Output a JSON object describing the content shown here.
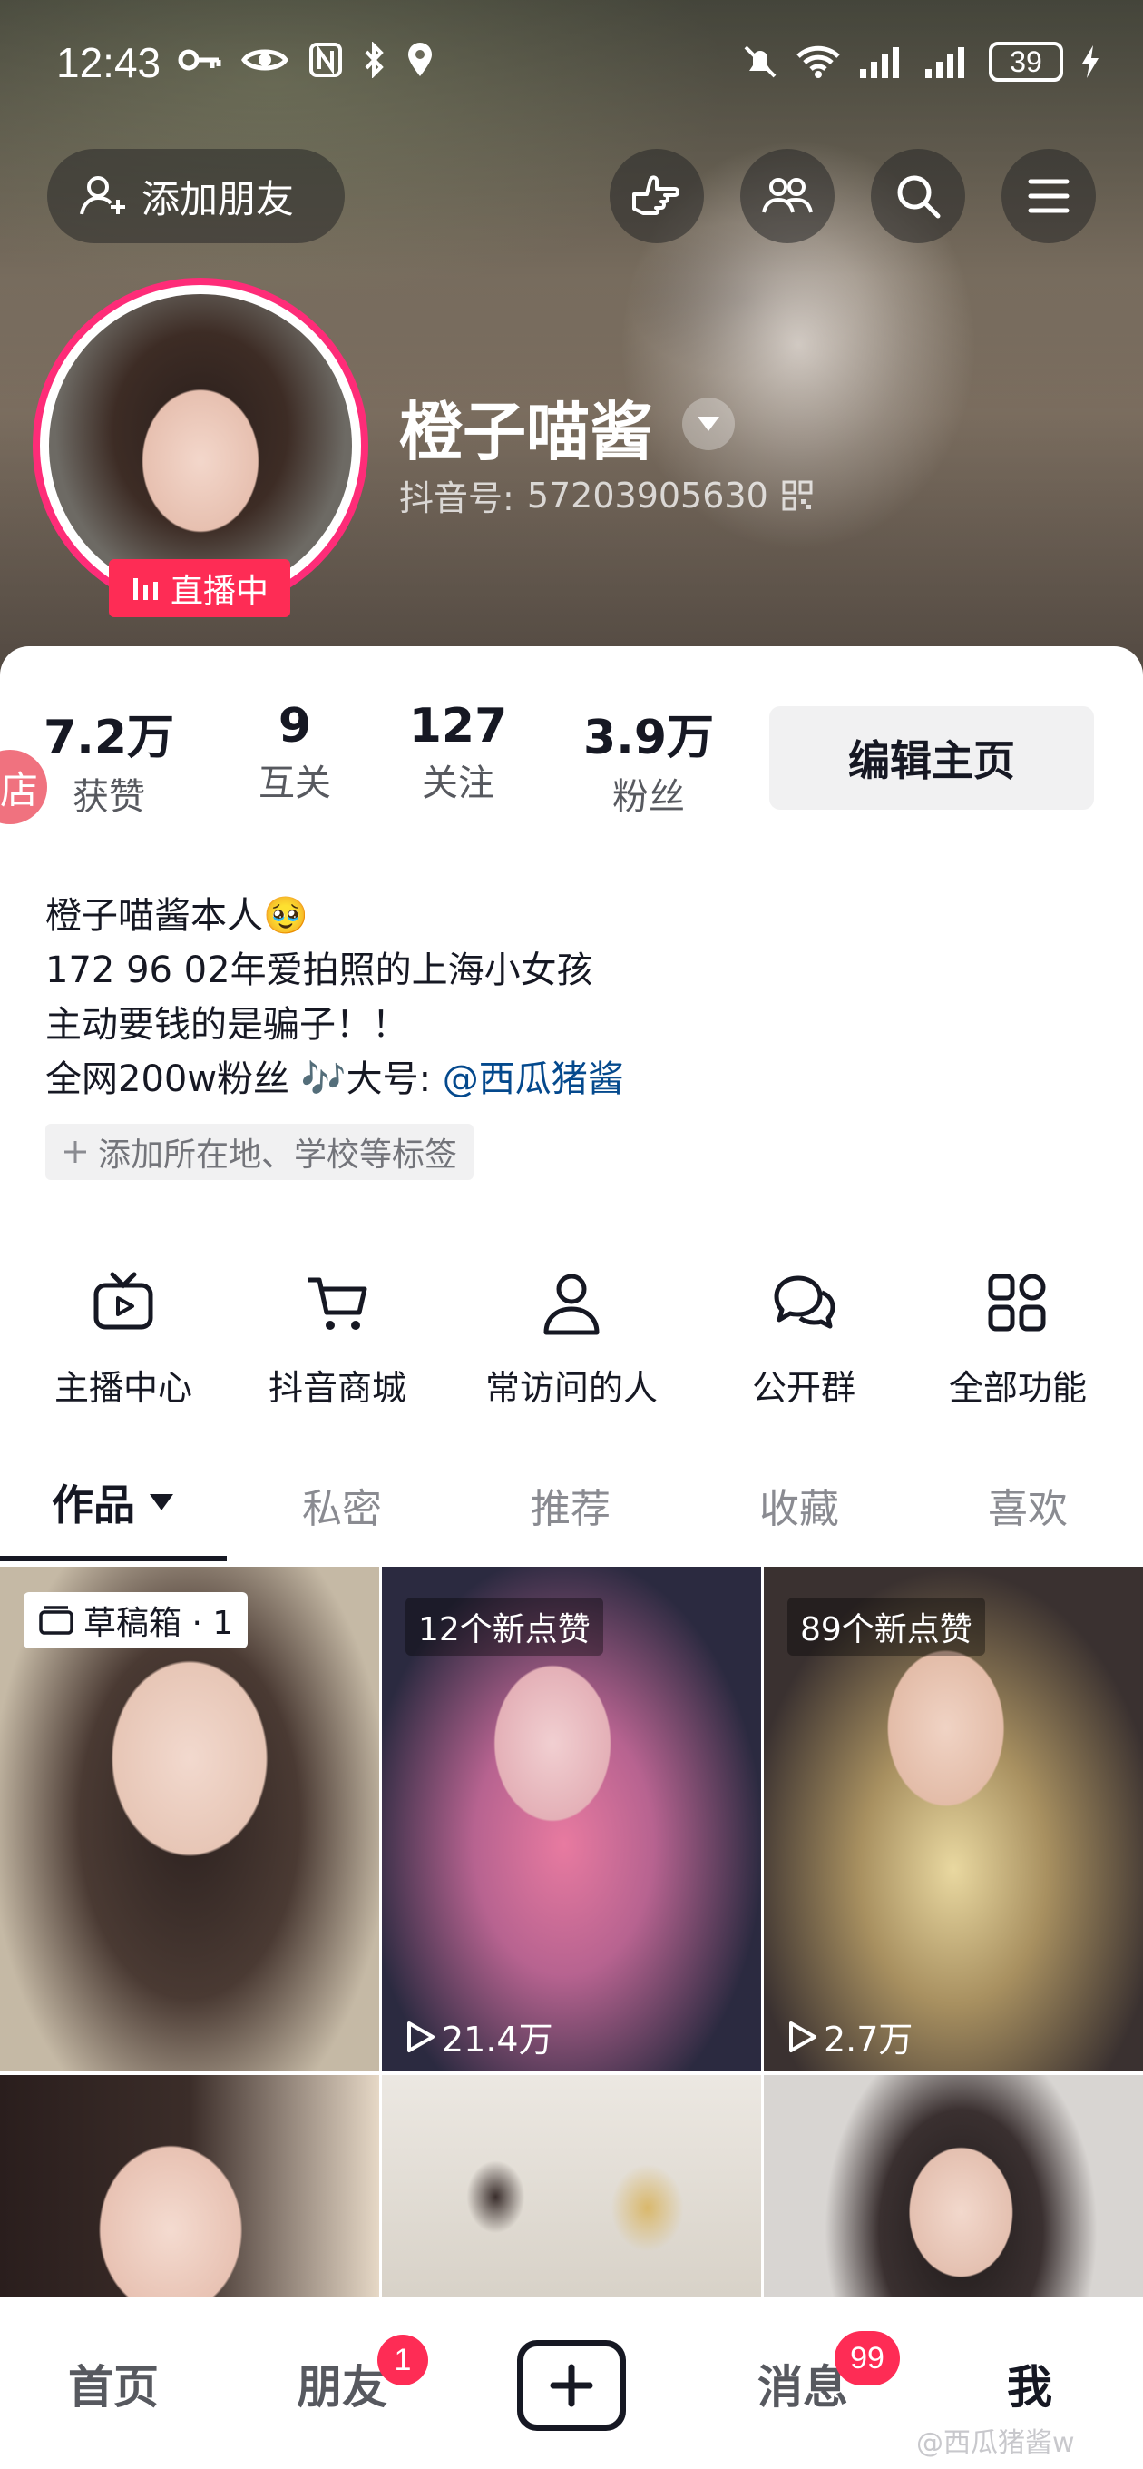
{
  "status_bar": {
    "time": "12:43",
    "battery": "39"
  },
  "header": {
    "add_friend_label": "添加朋友"
  },
  "profile": {
    "name": "橙子喵酱",
    "douyin_id_label": "抖音号:",
    "douyin_id": "57203905630",
    "live_label": "直播中"
  },
  "stats": [
    {
      "value": "7.2万",
      "label": "获赞"
    },
    {
      "value": "9",
      "label": "互关"
    },
    {
      "value": "127",
      "label": "关注"
    },
    {
      "value": "3.9万",
      "label": "粉丝"
    }
  ],
  "edit_button_label": "编辑主页",
  "side_tab_label": "店",
  "bio": {
    "line1": "橙子喵酱本人🥹",
    "line2": "172 96 02年爱拍照的上海小女孩",
    "line3": "主动要钱的是骗子！！",
    "line4_prefix": "全网200w粉丝 🎶大号:",
    "line4_mention": "@西瓜猪酱",
    "tag_add_label": "添加所在地、学校等标签"
  },
  "quick_actions": [
    {
      "label": "主播中心",
      "icon": "tv-icon"
    },
    {
      "label": "抖音商城",
      "icon": "cart-icon"
    },
    {
      "label": "常访问的人",
      "icon": "person-icon"
    },
    {
      "label": "公开群",
      "icon": "group-chat-icon"
    },
    {
      "label": "全部功能",
      "icon": "grid-icon"
    }
  ],
  "tabs": [
    "作品",
    "私密",
    "推荐",
    "收藏",
    "喜欢"
  ],
  "videos": [
    {
      "label": "草稿箱 · 1",
      "plays": ""
    },
    {
      "label": "12个新点赞",
      "plays": "21.4万"
    },
    {
      "label": "89个新点赞",
      "plays": "2.7万"
    },
    {
      "label": "",
      "plays": ""
    },
    {
      "label": "",
      "plays": ""
    },
    {
      "label": "",
      "plays": ""
    }
  ],
  "nav": {
    "home": "首页",
    "friends": "朋友",
    "friends_badge": "1",
    "messages": "消息",
    "messages_badge": "99",
    "me": "我"
  },
  "watermark": "@西瓜猪酱w",
  "colors": {
    "accent": "#fe2c55",
    "link": "#04498d",
    "ring": "#fe2c78"
  }
}
